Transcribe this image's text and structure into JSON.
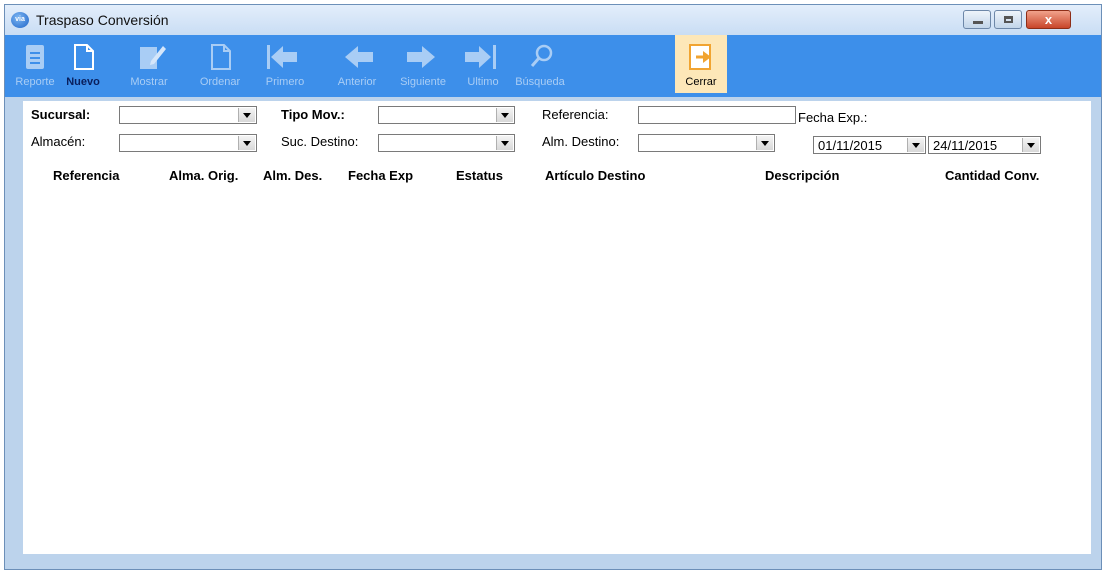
{
  "window": {
    "title": "Traspaso Conversión",
    "icon_text": "via",
    "controls": {
      "minimize": "minimize-icon",
      "maximize": "maximize-icon",
      "close_glyph": "x"
    }
  },
  "toolbar": {
    "buttons": [
      {
        "label": "Reporte",
        "icon": "report-icon"
      },
      {
        "label": "Nuevo",
        "icon": "new-document-icon"
      },
      {
        "label": "Mostrar",
        "icon": "edit-icon"
      },
      {
        "label": "Ordenar",
        "icon": "document-icon"
      },
      {
        "label": "Primero",
        "icon": "first-icon"
      },
      {
        "label": "Anterior",
        "icon": "previous-icon"
      },
      {
        "label": "Siguiente",
        "icon": "next-icon"
      },
      {
        "label": "Ultimo",
        "icon": "last-icon"
      },
      {
        "label": "Búsqueda",
        "icon": "search-icon"
      },
      {
        "label": "Cerrar",
        "icon": "exit-icon"
      }
    ]
  },
  "filters": {
    "sucursal_label": "Sucursal:",
    "sucursal_value": "",
    "tipo_mov_label": "Tipo Mov.:",
    "tipo_mov_value": "",
    "referencia_label": "Referencia:",
    "referencia_value": "",
    "fecha_exp_label": "Fecha Exp.:",
    "almacen_label": "Almacén:",
    "almacen_value": "",
    "suc_destino_label": "Suc. Destino:",
    "suc_destino_value": "",
    "alm_destino_label": "Alm. Destino:",
    "alm_destino_value": "",
    "fecha_desde": "01/11/2015",
    "fecha_hasta": "24/11/2015"
  },
  "grid": {
    "columns": [
      "Referencia",
      "Alma. Orig.",
      "Alm. Des.",
      "Fecha Exp",
      "Estatus",
      "Artículo Destino",
      "Descripción",
      "Cantidad Conv."
    ],
    "rows": []
  },
  "colors": {
    "toolbar": "#3d8fea",
    "close_highlight": "#fde7b8",
    "frame": "#bcd3ec"
  }
}
